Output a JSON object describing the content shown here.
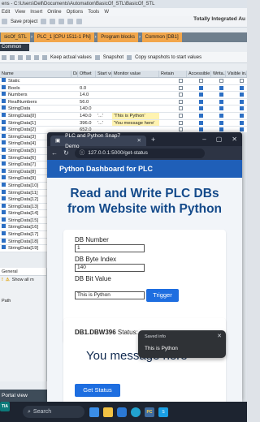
{
  "tia": {
    "title": "ens - C:\\Users\\Dell\\Documents\\Automation\\BasicOf_STL\\BasicOf_STL",
    "menu": [
      "Edit",
      "View",
      "Insert",
      "Online",
      "Options",
      "Tools",
      "W"
    ],
    "save_label": "Save project",
    "brand": "Totally Integrated Au",
    "breadcrumbs": [
      "sicOf_STL",
      "PLC_1 [CPU 1511-1 PN]",
      "Program blocks",
      "Common [DB1]"
    ],
    "panel_tab": "Common",
    "tools": [
      "Keep actual values",
      "Snapshot",
      "Copy snapshots to start values"
    ],
    "columns": [
      "Name",
      "Data type",
      "Offset",
      "Start value",
      "Monitor value",
      "Retain",
      "Accessible f...",
      "Writa...",
      "Visible in..."
    ],
    "rows": [
      {
        "name": "Static",
        "off": "",
        "start": "",
        "mon": ""
      },
      {
        "name": "Bools",
        "off": "0.0",
        "start": "",
        "mon": ""
      },
      {
        "name": "Numbers",
        "off": "14.0",
        "start": "",
        "mon": ""
      },
      {
        "name": "RealNumbers",
        "off": "56.0",
        "start": "",
        "mon": ""
      },
      {
        "name": "StringData",
        "off": "140.0",
        "start": "",
        "mon": ""
      },
      {
        "name": "StringData[0]",
        "off": "140.0",
        "start": "'...'",
        "mon": "'This is Python'"
      },
      {
        "name": "StringData[1]",
        "off": "396.0",
        "start": "'...'",
        "mon": "'You message here'"
      },
      {
        "name": "StringData[2]",
        "off": "652.0",
        "start": "",
        "mon": ""
      },
      {
        "name": "StringData[3]",
        "off": "",
        "start": "",
        "mon": ""
      },
      {
        "name": "StringData[4]",
        "off": "",
        "start": "",
        "mon": ""
      },
      {
        "name": "StringData[5]",
        "off": "",
        "start": "",
        "mon": ""
      },
      {
        "name": "StringData[6]",
        "off": "",
        "start": "",
        "mon": ""
      },
      {
        "name": "StringData[7]",
        "off": "",
        "start": "",
        "mon": ""
      },
      {
        "name": "StringData[8]",
        "off": "",
        "start": "",
        "mon": ""
      },
      {
        "name": "StringData[9]",
        "off": "",
        "start": "",
        "mon": ""
      },
      {
        "name": "StringData[10]",
        "off": "",
        "start": "",
        "mon": ""
      },
      {
        "name": "StringData[11]",
        "off": "",
        "start": "",
        "mon": ""
      },
      {
        "name": "StringData[12]",
        "off": "",
        "start": "",
        "mon": ""
      },
      {
        "name": "StringData[13]",
        "off": "",
        "start": "",
        "mon": ""
      },
      {
        "name": "StringData[14]",
        "off": "",
        "start": "",
        "mon": ""
      },
      {
        "name": "StringData[15]",
        "off": "",
        "start": "",
        "mon": ""
      },
      {
        "name": "StringData[16]",
        "off": "",
        "start": "",
        "mon": ""
      },
      {
        "name": "StringData[17]",
        "off": "",
        "start": "",
        "mon": ""
      },
      {
        "name": "StringData[18]",
        "off": "",
        "start": "",
        "mon": ""
      },
      {
        "name": "StringData[19]",
        "off": "",
        "start": "",
        "mon": ""
      }
    ],
    "lower_left": {
      "tab": "General",
      "show_all": "Show all m",
      "path_label": "Path"
    },
    "portal_view": "Portal view"
  },
  "browser": {
    "tab_title": "PLC and Python Snap7 Demo",
    "url": "127.0.0.1:5000/get-status",
    "page_header": "Python Dashboard for PLC",
    "big_title_1": "Read and Write PLC DBs",
    "big_title_2": "from Website with Python",
    "db_number_label": "DB Number",
    "db_number_value": "1",
    "db_byte_label": "DB Byte Index",
    "db_byte_value": "140",
    "db_bit_label": "DB Bit Value",
    "db_bit_value": "This is Python",
    "trigger_label": "Trigger",
    "status_prefix": "DB1.DBW396",
    "status_suffix": "Status:",
    "message": "You message here",
    "get_status_label": "Get Status",
    "toast_title": "Saved info",
    "toast_text": "This is Python"
  },
  "taskbar": {
    "search_placeholder": "Search"
  }
}
